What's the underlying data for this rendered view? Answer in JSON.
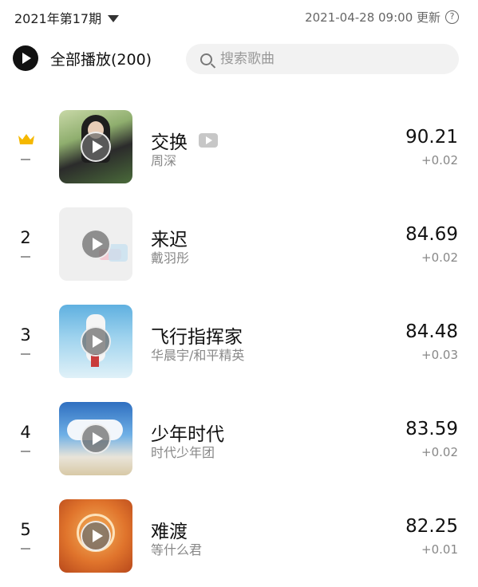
{
  "header": {
    "period": "2021年第17期",
    "updated": "2021-04-28 09:00 更新",
    "help_glyph": "?"
  },
  "actions": {
    "play_all": "全部播放(200)",
    "search_placeholder": "搜索歌曲"
  },
  "songs": [
    {
      "rank": "",
      "crown": true,
      "title": "交换",
      "has_mv": true,
      "artist": "周深",
      "score": "90.21",
      "delta": "+0.02"
    },
    {
      "rank": "2",
      "crown": false,
      "title": "来迟",
      "has_mv": false,
      "artist": "戴羽彤",
      "score": "84.69",
      "delta": "+0.02"
    },
    {
      "rank": "3",
      "crown": false,
      "title": "飞行指挥家",
      "has_mv": false,
      "artist": "华晨宇/和平精英",
      "score": "84.48",
      "delta": "+0.03"
    },
    {
      "rank": "4",
      "crown": false,
      "title": "少年时代",
      "has_mv": false,
      "artist": "时代少年团",
      "score": "83.59",
      "delta": "+0.02"
    },
    {
      "rank": "5",
      "crown": false,
      "title": "难渡",
      "has_mv": false,
      "artist": "等什么君",
      "score": "82.25",
      "delta": "+0.01"
    }
  ],
  "colors": {
    "crown": "#f5b800",
    "text_primary": "#111111",
    "text_secondary": "#888888",
    "search_bg": "#f2f2f2"
  },
  "icons": {
    "crown": "crown-icon",
    "mv": "mv-video-icon",
    "play": "play-icon",
    "search": "search-icon",
    "help": "help-circle-icon",
    "dropdown": "caret-down-icon"
  }
}
